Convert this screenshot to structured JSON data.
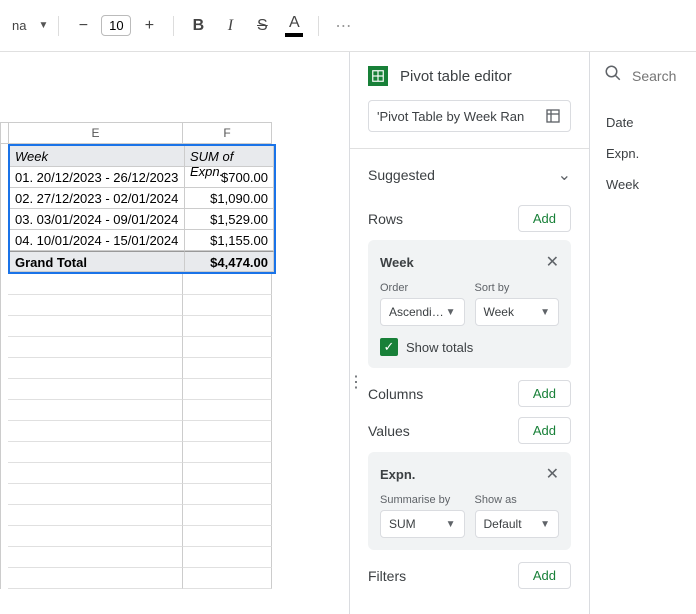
{
  "toolbar": {
    "font_partial": "na",
    "font_size": "10",
    "bold": "B",
    "italic": "I",
    "text_color_letter": "A"
  },
  "sheet": {
    "columns": [
      "E",
      "F"
    ],
    "headers": [
      "Week",
      "SUM of Expn."
    ],
    "rows": [
      [
        "01. 20/12/2023 - 26/12/2023",
        "$700.00"
      ],
      [
        "02. 27/12/2023 - 02/01/2024",
        "$1,090.00"
      ],
      [
        "03. 03/01/2024 - 09/01/2024",
        "$1,529.00"
      ],
      [
        "04. 10/01/2024 - 15/01/2024",
        "$1,155.00"
      ]
    ],
    "total": [
      "Grand Total",
      "$4,474.00"
    ]
  },
  "editor": {
    "title": "Pivot table editor",
    "source_range": "'Pivot Table by Week Ran",
    "suggested": "Suggested",
    "rows_label": "Rows",
    "columns_label": "Columns",
    "values_label": "Values",
    "filters_label": "Filters",
    "add_label": "Add",
    "row_card": {
      "name": "Week",
      "order_label": "Order",
      "order_value": "Ascendi…",
      "sort_label": "Sort by",
      "sort_value": "Week",
      "show_totals": "Show totals"
    },
    "value_card": {
      "name": "Expn.",
      "summarise_label": "Summarise by",
      "summarise_value": "SUM",
      "showas_label": "Show as",
      "showas_value": "Default"
    }
  },
  "search": {
    "placeholder": "Search",
    "fields": [
      "Date",
      "Expn.",
      "Week"
    ]
  }
}
